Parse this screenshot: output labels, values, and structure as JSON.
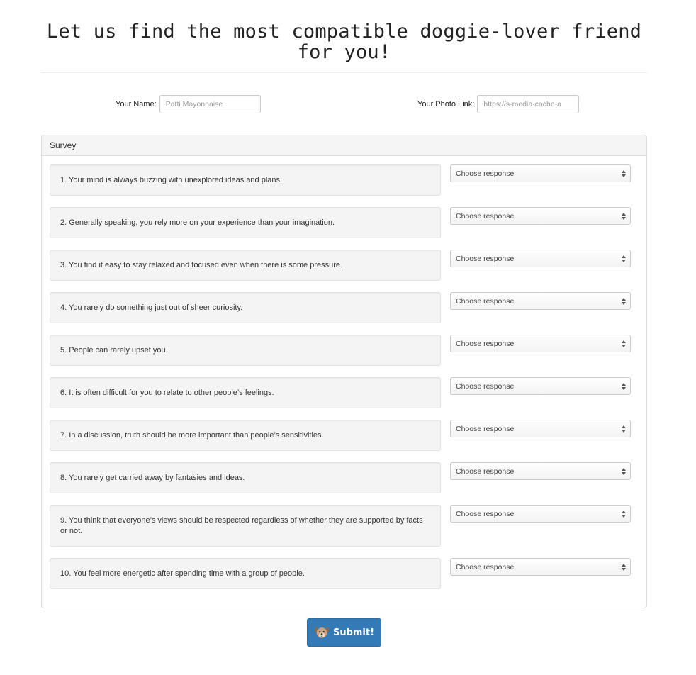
{
  "header": {
    "title": "Let us find the most compatible doggie-lover friend for you!"
  },
  "form": {
    "name_label": "Your Name:",
    "name_placeholder": "Patti Mayonnaise",
    "photo_label": "Your Photo Link:",
    "photo_placeholder": "https://s-media-cache-a"
  },
  "survey": {
    "heading": "Survey",
    "select_placeholder": "Choose response",
    "questions": [
      "1. Your mind is always buzzing with unexplored ideas and plans.",
      "2. Generally speaking, you rely more on your experience than your imagination.",
      "3. You find it easy to stay relaxed and focused even when there is some pressure.",
      "4. You rarely do something just out of sheer curiosity.",
      "5. People can rarely upset you.",
      "6. It is often difficult for you to relate to other people’s feelings.",
      "7. In a discussion, truth should be more important than people’s sensitivities.",
      "8. You rarely get carried away by fantasies and ideas.",
      "9. You think that everyone’s views should be respected regardless of whether they are supported by facts or not.",
      "10. You feel more energetic after spending time with a group of people."
    ]
  },
  "submit": {
    "label": "Submit!",
    "icon": "dog-face-icon"
  },
  "colors": {
    "primary": "#337ab7",
    "well_background": "#f4f4f4",
    "panel_heading_background": "#f5f5f5"
  }
}
